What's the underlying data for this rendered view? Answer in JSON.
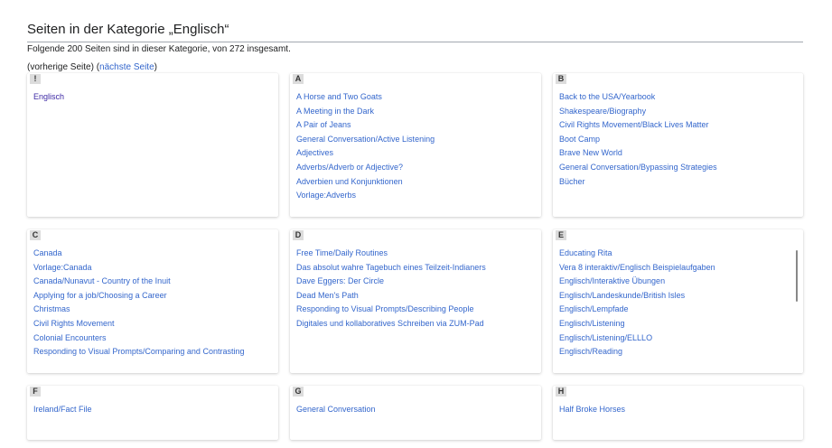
{
  "heading": "Seiten in der Kategorie „Englisch“",
  "summary": "Folgende 200 Seiten sind in dieser Kategorie, von 272 insgesamt.",
  "nav": {
    "prev_text": "(vorherige Seite)",
    "open_paren": "(",
    "next_link": "nächste Seite",
    "close_paren": ")"
  },
  "groups": [
    {
      "letter": "!",
      "items": [
        "Englisch"
      ]
    },
    {
      "letter": "A",
      "items": [
        "A Horse and Two Goats",
        "A Meeting in the Dark",
        "A Pair of Jeans",
        "General Conversation/Active Listening",
        "Adjectives",
        "Adverbs/Adverb or Adjective?",
        "Adverbien und Konjunktionen",
        "Vorlage:Adverbs"
      ]
    },
    {
      "letter": "B",
      "items": [
        "Back to the USA/Yearbook",
        "Shakespeare/Biography",
        "Civil Rights Movement/Black Lives Matter",
        "Boot Camp",
        "Brave New World",
        "General Conversation/Bypassing Strategies",
        "Bücher"
      ]
    },
    {
      "letter": "C",
      "items": [
        "Canada",
        "Vorlage:Canada",
        "Canada/Nunavut - Country of the Inuit",
        "Applying for a job/Choosing a Career",
        "Christmas",
        "Civil Rights Movement",
        "Colonial Encounters",
        "Responding to Visual Prompts/Comparing and Contrasting"
      ]
    },
    {
      "letter": "D",
      "items": [
        "Free Time/Daily Routines",
        "Das absolut wahre Tagebuch eines Teilzeit-Indianers",
        "Dave Eggers: Der Circle",
        "Dead Men's Path",
        "Responding to Visual Prompts/Describing People",
        "Digitales und kollaboratives Schreiben via ZUM-Pad"
      ]
    },
    {
      "letter": "E",
      "items": [
        "Educating Rita",
        "Vera 8 interaktiv/Englisch Beispielaufgaben",
        "Englisch/Interaktive Übungen",
        "Englisch/Landeskunde/British Isles",
        "Englisch/Lempfade",
        "Englisch/Listening",
        "Englisch/Listening/ELLLO",
        "Englisch/Reading"
      ]
    },
    {
      "letter": "F",
      "items": [
        "Ireland/Fact File"
      ]
    },
    {
      "letter": "G",
      "items": [
        "General Conversation"
      ]
    },
    {
      "letter": "H",
      "items": [
        "Half Broke Horses"
      ]
    }
  ]
}
